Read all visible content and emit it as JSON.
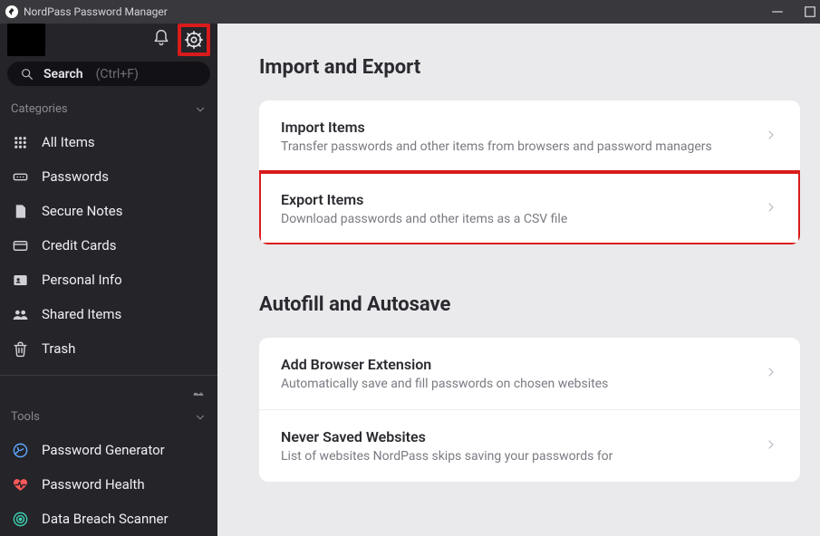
{
  "window": {
    "title": "NordPass Password Manager"
  },
  "sidebar": {
    "search_label": "Search",
    "search_hint": "(Ctrl+F)",
    "categories_label": "Categories",
    "tools_label": "Tools",
    "categories": [
      {
        "id": "all",
        "label": "All Items",
        "icon": "grid-icon"
      },
      {
        "id": "pw",
        "label": "Passwords",
        "icon": "password-icon"
      },
      {
        "id": "notes",
        "label": "Secure Notes",
        "icon": "note-icon"
      },
      {
        "id": "cards",
        "label": "Credit Cards",
        "icon": "card-icon"
      },
      {
        "id": "personal",
        "label": "Personal Info",
        "icon": "person-card-icon"
      },
      {
        "id": "shared",
        "label": "Shared Items",
        "icon": "people-icon"
      },
      {
        "id": "trash",
        "label": "Trash",
        "icon": "trash-icon"
      }
    ],
    "tools": [
      {
        "id": "gen",
        "label": "Password Generator",
        "icon": "generator-icon"
      },
      {
        "id": "health",
        "label": "Password Health",
        "icon": "heart-icon"
      },
      {
        "id": "breach",
        "label": "Data Breach Scanner",
        "icon": "radar-icon"
      }
    ]
  },
  "main": {
    "sections": [
      {
        "heading": "Import and Export",
        "cards": [
          {
            "id": "import",
            "title": "Import Items",
            "subtitle": "Transfer passwords and other items from browsers and password managers",
            "highlight": false
          },
          {
            "id": "export",
            "title": "Export Items",
            "subtitle": "Download passwords and other items as a CSV file",
            "highlight": true
          }
        ]
      },
      {
        "heading": "Autofill and Autosave",
        "cards": [
          {
            "id": "ext",
            "title": "Add Browser Extension",
            "subtitle": "Automatically save and fill passwords on chosen websites",
            "highlight": false
          },
          {
            "id": "never",
            "title": "Never Saved Websites",
            "subtitle": "List of websites NordPass skips saving your passwords for",
            "highlight": false
          }
        ]
      }
    ]
  }
}
